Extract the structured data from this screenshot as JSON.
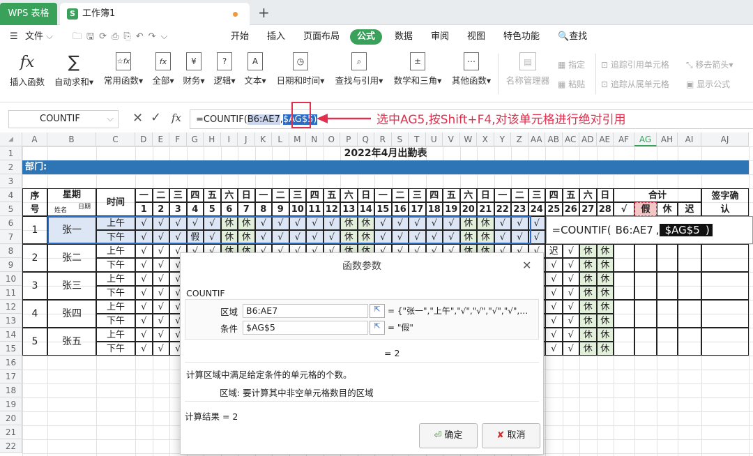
{
  "app": {
    "tab_app": "WPS 表格",
    "tab_book": "工作簿1",
    "tab_new": "+"
  },
  "menu": {
    "file": "文件",
    "items": [
      "开始",
      "插入",
      "页面布局",
      "公式",
      "数据",
      "审阅",
      "视图",
      "特色功能"
    ],
    "search": "查找"
  },
  "ribbon": {
    "buttons": [
      "插入函数",
      "自动求和",
      "常用函数",
      "全部",
      "财务",
      "逻辑",
      "文本",
      "日期和时间",
      "查找与引用",
      "数学和三角",
      "其他函数",
      "名称管理器"
    ],
    "small": [
      "指定",
      "粘贴",
      "追踪引用单元格",
      "移去箭头",
      "追踪从属单元格",
      "显示公式"
    ]
  },
  "formula_bar": {
    "name_box": "COUNTIF",
    "fx": "fx",
    "prefix": "=COUNTIF(",
    "range": "B6:AE7",
    "sep": ",",
    "ref": "$AG$5)",
    "callout": "选中AG5,按Shift+F4,对该单元格进行绝对引用"
  },
  "sheet": {
    "columns": [
      "A",
      "B",
      "C",
      "D",
      "E",
      "F",
      "G",
      "H",
      "I",
      "J",
      "K",
      "L",
      "M",
      "N",
      "O",
      "P",
      "Q",
      "R",
      "S",
      "T",
      "U",
      "V",
      "W",
      "X",
      "Y",
      "Z",
      "AA",
      "AB",
      "AC",
      "AD",
      "AE",
      "AF",
      "AG",
      "AH",
      "AI",
      "AJ"
    ],
    "rows": [
      "1",
      "2",
      "3",
      "4",
      "5",
      "6",
      "7",
      "8",
      "9",
      "10",
      "11",
      "12",
      "13",
      "14",
      "15",
      "16",
      "17",
      "18",
      "19",
      "20",
      "21",
      "22"
    ],
    "title": "2022年4月出勤表",
    "dept_label": "部门:",
    "hdr_seq": "序号",
    "hdr_week": "星期",
    "hdr_date": "日期",
    "hdr_name": "姓名",
    "hdr_time": "时间",
    "weekdays": [
      "一",
      "二",
      "三",
      "四",
      "五",
      "六",
      "日",
      "一",
      "二",
      "三",
      "四",
      "五",
      "六",
      "日",
      "一",
      "二",
      "三",
      "四",
      "五",
      "六",
      "日",
      "一",
      "二",
      "三",
      "四",
      "五",
      "六",
      "日"
    ],
    "days": [
      "1",
      "2",
      "3",
      "4",
      "5",
      "6",
      "7",
      "8",
      "9",
      "10",
      "11",
      "12",
      "13",
      "14",
      "15",
      "16",
      "17",
      "18",
      "19",
      "20",
      "21",
      "22",
      "23",
      "24",
      "25",
      "26",
      "27",
      "28"
    ],
    "hdr_total": "合计",
    "total_cols": [
      "√",
      "假",
      "休",
      "迟"
    ],
    "hdr_sign": "签字确认",
    "am": "上午",
    "pm": "下午",
    "check": "√",
    "rest": "休",
    "leave": "假",
    "late": "迟",
    "employees": [
      {
        "no": "1",
        "name": "张一"
      },
      {
        "no": "2",
        "name": "张二"
      },
      {
        "no": "3",
        "name": "张三"
      },
      {
        "no": "4",
        "name": "张四"
      },
      {
        "no": "5",
        "name": "张五"
      }
    ],
    "cell_formula": {
      "prefix": "=COUNTIF(",
      "range": "B6:AE7",
      "sep": ",",
      "ref": "$AG$5",
      "close": ")"
    }
  },
  "dialog": {
    "title": "函数参数",
    "func": "COUNTIF",
    "arg1_label": "区域",
    "arg1_value": "B6:AE7",
    "arg1_result": "= {\"张一\",\"上午\",\"√\",\"√\",\"√\",\"√\",…",
    "arg2_label": "条件",
    "arg2_value": "$AG$5",
    "arg2_result": "= \"假\"",
    "eval": "= 2",
    "desc": "计算区域中满足给定条件的单元格的个数。",
    "arg_desc": "区域:  要计算其中非空单元格数目的区域",
    "result": "计算结果 = 2",
    "ok": "确定",
    "cancel": "取消"
  },
  "colors": {
    "wps_green": "#3aa15b",
    "header_blue": "#2e75b6",
    "rest_green": "#e2efda",
    "select_fill": "#dde6f5",
    "callout_red": "#e0304e"
  }
}
